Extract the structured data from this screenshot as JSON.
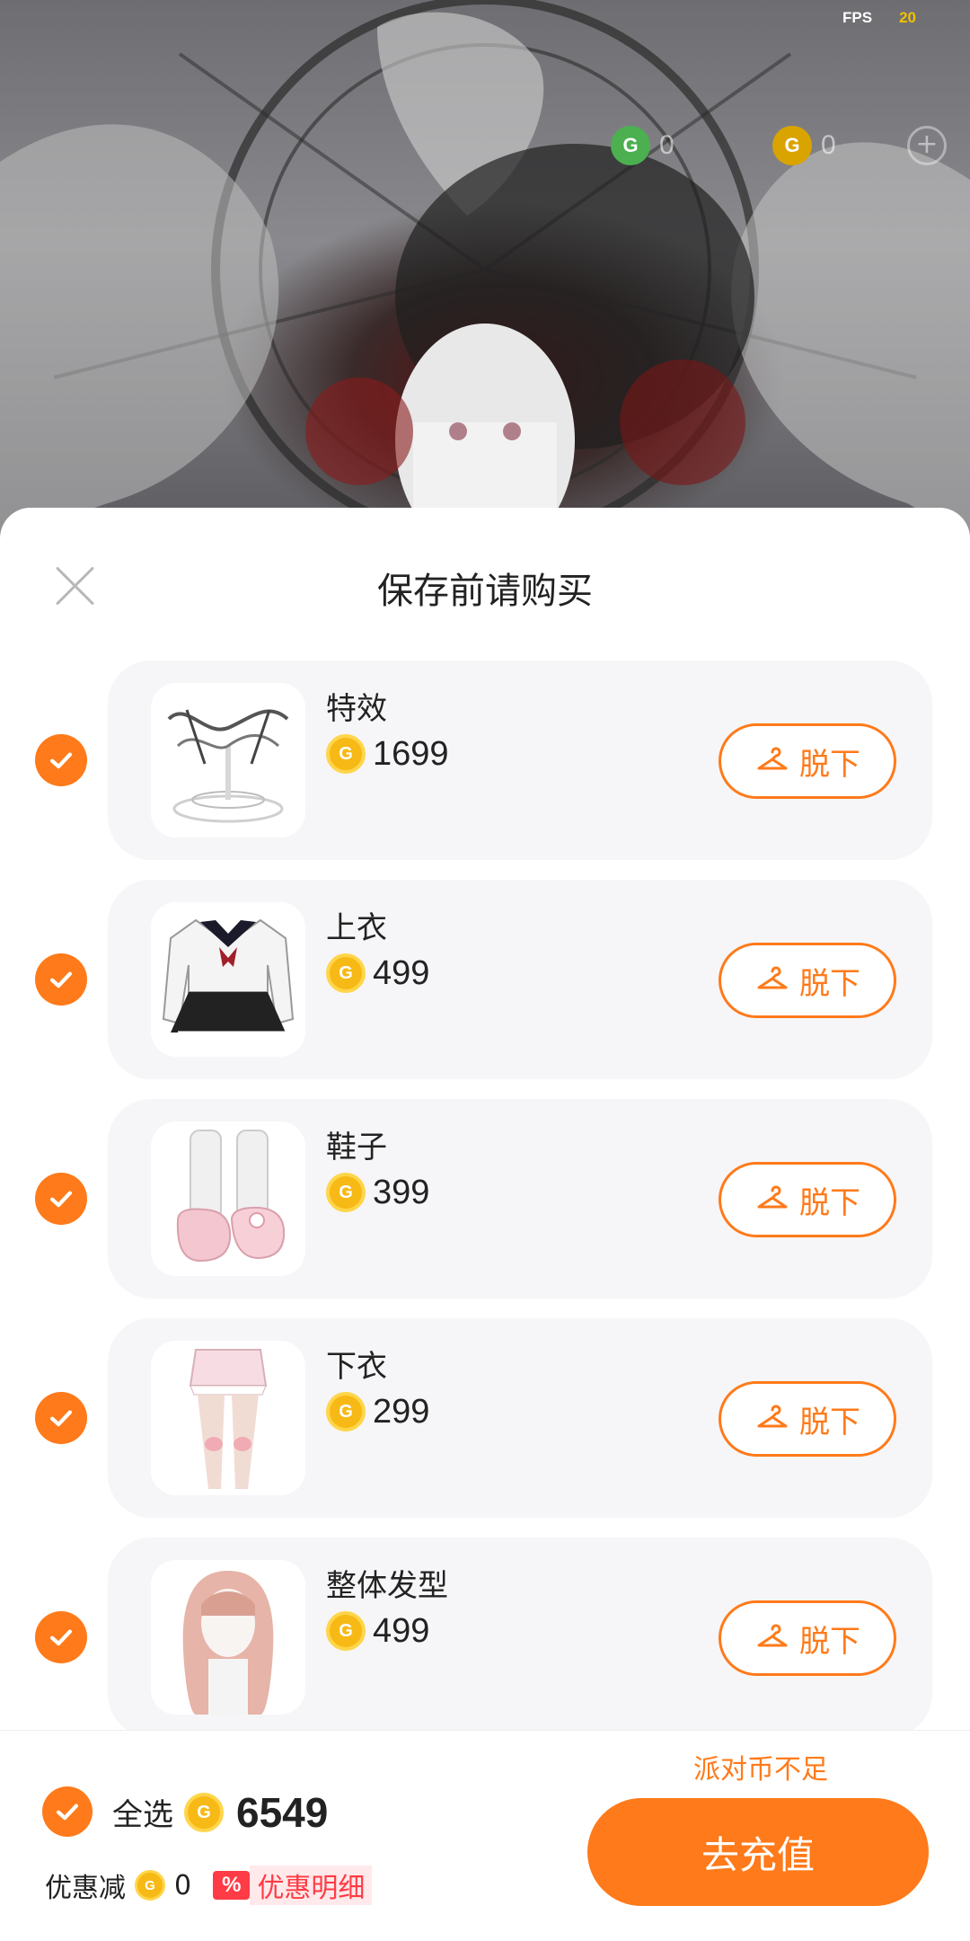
{
  "hud": {
    "fps_label": "FPS",
    "fps_value": "20",
    "green_coins": "0",
    "gold_coins": "0"
  },
  "sheet": {
    "title": "保存前请购买",
    "remove_label": "脱下",
    "items": [
      {
        "name": "特效",
        "price": "1699",
        "checked": true,
        "thumb_icon": "effect-thumbnail"
      },
      {
        "name": "上衣",
        "price": "499",
        "checked": true,
        "thumb_icon": "top-thumbnail"
      },
      {
        "name": "鞋子",
        "price": "399",
        "checked": true,
        "thumb_icon": "shoes-thumbnail"
      },
      {
        "name": "下衣",
        "price": "299",
        "checked": true,
        "thumb_icon": "bottom-thumbnail"
      },
      {
        "name": "整体发型",
        "price": "499",
        "checked": true,
        "thumb_icon": "hairstyle-thumbnail"
      }
    ]
  },
  "footer": {
    "insufficient_text": "派对币不足",
    "select_all_label": "全选",
    "total": "6549",
    "discount_label": "优惠减",
    "discount_value": "0",
    "discount_badge": "%",
    "discount_detail": "优惠明细",
    "recharge_label": "去充值"
  },
  "colors": {
    "accent": "#ff7a1a",
    "coin": "#f7b916",
    "discount_red": "#ff3b45"
  }
}
